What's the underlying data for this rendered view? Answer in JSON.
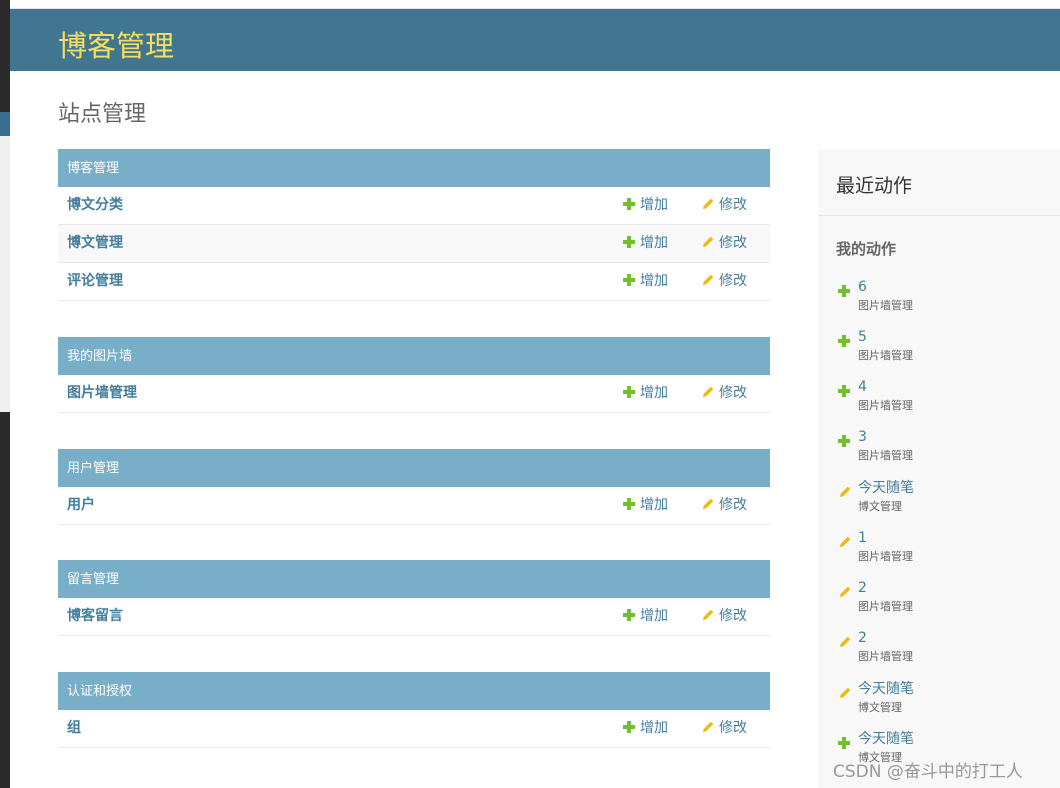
{
  "header": {
    "branding": "博客管理"
  },
  "page_title": "站点管理",
  "modules": [
    {
      "caption": "博客管理",
      "models": [
        {
          "name": "博文分类",
          "add": "增加",
          "change": "修改"
        },
        {
          "name": "博文管理",
          "add": "增加",
          "change": "修改"
        },
        {
          "name": "评论管理",
          "add": "增加",
          "change": "修改"
        }
      ]
    },
    {
      "caption": "我的图片墙",
      "models": [
        {
          "name": "图片墙管理",
          "add": "增加",
          "change": "修改"
        }
      ]
    },
    {
      "caption": "用户管理",
      "models": [
        {
          "name": "用户",
          "add": "增加",
          "change": "修改"
        }
      ]
    },
    {
      "caption": "留言管理",
      "models": [
        {
          "name": "博客留言",
          "add": "增加",
          "change": "修改"
        }
      ]
    },
    {
      "caption": "认证和授权",
      "models": [
        {
          "name": "组",
          "add": "增加",
          "change": "修改"
        }
      ]
    }
  ],
  "recent_actions": {
    "title": "最近动作",
    "subtitle": "我的动作",
    "items": [
      {
        "type": "add",
        "icon": "plus-icon",
        "object": "6",
        "content_type": "图片墙管理"
      },
      {
        "type": "add",
        "icon": "plus-icon",
        "object": "5",
        "content_type": "图片墙管理"
      },
      {
        "type": "add",
        "icon": "plus-icon",
        "object": "4",
        "content_type": "图片墙管理"
      },
      {
        "type": "add",
        "icon": "plus-icon",
        "object": "3",
        "content_type": "图片墙管理"
      },
      {
        "type": "change",
        "icon": "pencil-icon",
        "object": "今天随笔",
        "content_type": "博文管理"
      },
      {
        "type": "change",
        "icon": "pencil-icon",
        "object": "1",
        "content_type": "图片墙管理"
      },
      {
        "type": "change",
        "icon": "pencil-icon",
        "object": "2",
        "content_type": "图片墙管理"
      },
      {
        "type": "change",
        "icon": "pencil-icon",
        "object": "2",
        "content_type": "图片墙管理"
      },
      {
        "type": "change",
        "icon": "pencil-icon",
        "object": "今天随笔",
        "content_type": "博文管理"
      },
      {
        "type": "add",
        "icon": "plus-icon",
        "object": "今天随笔",
        "content_type": "博文管理"
      }
    ]
  },
  "watermark": "CSDN @奋斗中的打工人",
  "colors": {
    "header_bg": "#417690",
    "branding": "#f5dd5d",
    "caption_bg": "#79aec8",
    "link": "#447e9b",
    "add_icon": "#70bf2b",
    "change_icon": "#efb80b"
  }
}
